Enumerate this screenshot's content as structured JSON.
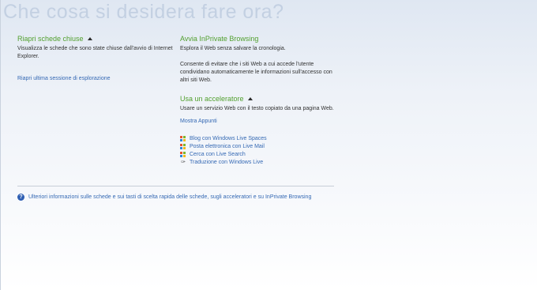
{
  "page": {
    "title": "Che cosa si desidera fare ora?"
  },
  "reopen": {
    "heading": "Riapri schede chiuse",
    "description": "Visualizza le schede che sono state chiuse dall'avvio di Internet Explorer.",
    "last_session_link": "Riapri ultima sessione di esplorazione"
  },
  "inprivate": {
    "heading": "Avvia InPrivate Browsing",
    "description1": "Esplora il Web senza salvare la cronologia.",
    "description2": "Consente di evitare che i siti Web a cui accede l'utente condividano automaticamente le informazioni sull'accesso con altri siti Web."
  },
  "accelerator": {
    "heading": "Usa un acceleratore",
    "description": "Usare un servizio Web con il testo copiato da una pagina Web.",
    "show_clipboard": "Mostra Appunti",
    "items": [
      {
        "label": "Blog con Windows Live Spaces",
        "icon": "windows-live-icon"
      },
      {
        "label": "Posta elettronica con Live Mail",
        "icon": "windows-live-icon"
      },
      {
        "label": "Cerca con Live Search",
        "icon": "windows-live-icon"
      },
      {
        "label": "Traduzione con Windows Live",
        "icon": "translate-icon"
      }
    ]
  },
  "footer": {
    "help_link": "Ulteriori informazioni sulle schede e sui tasti di scelta rapida delle schede, sugli acceleratori e su InPrivate Browsing",
    "icon": "help-icon"
  },
  "colors": {
    "heading_green": "#52a02f",
    "link_blue": "#3569b4",
    "title_gray": "#c3d0e2"
  }
}
